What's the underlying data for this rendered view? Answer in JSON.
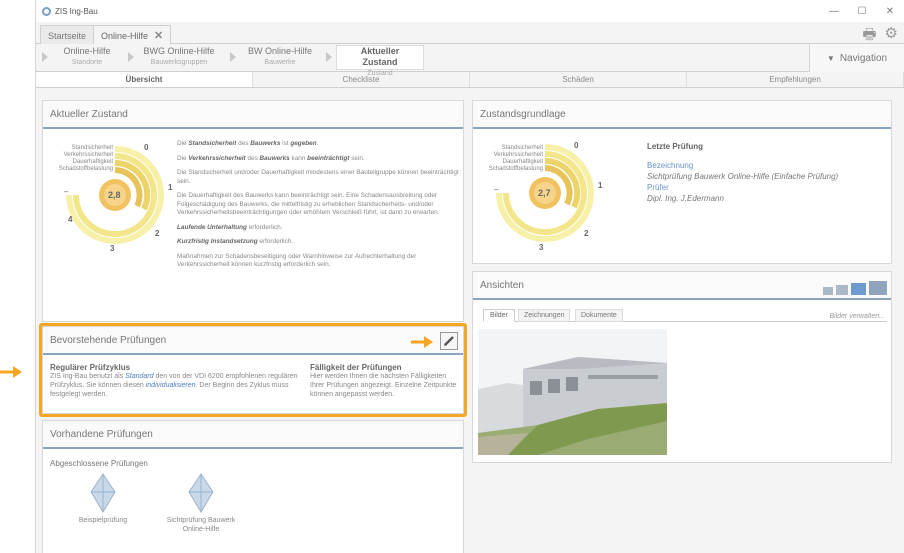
{
  "window": {
    "title": "ZIS Ing-Bau"
  },
  "tabs": [
    {
      "label": "Startseite"
    },
    {
      "label": "Online-Hilfe"
    }
  ],
  "breadcrumbs": [
    {
      "title": "Online-Hilfe",
      "sub": "Standorte"
    },
    {
      "title": "BWG Online-Hilfe",
      "sub": "Bauwerksgruppen"
    },
    {
      "title": "BW Online-Hilfe",
      "sub": "Bauwerke"
    },
    {
      "title": "Aktueller Zustand",
      "sub": "Zustand"
    }
  ],
  "nav_label": "Navigation",
  "subtabs": [
    "Übersicht",
    "Checkliste",
    "Schäden",
    "Empfehlungen"
  ],
  "zustand": {
    "title": "Aktueller Zustand",
    "gauge_labels": [
      "Standsicherheit",
      "Verkehrssicherheit",
      "Dauerhaftigkeit",
      "Schadstoffbelastung"
    ],
    "gauge_value": "2,8",
    "scale": [
      "0",
      "1",
      "2",
      "3",
      "4",
      "–"
    ],
    "texts": {
      "p1": {
        "a": "Die ",
        "b": "Standsicherheit",
        "c": " des ",
        "d": "Bauwerks",
        "e": " ist ",
        "f": "gegeben",
        "g": "."
      },
      "p2": {
        "a": "Die ",
        "b": "Verkehrssicherheit",
        "c": " des ",
        "d": "Bauwerks",
        "e": " kann ",
        "f": "beeinträchtigt",
        "g": " sein."
      },
      "p3": "Die Standsicherheit und/oder Dauerhaftigkeit mindestens einer Bauteilgruppe können beeinträchtigt sein.",
      "p4": "Die Dauerhaftigkeit des Bauwerks kann beeinträchtigt sein. Eine Schadensausbreitung oder Folgeschädigung des Bauwerks, die mittelfristig zu erheblichen Standsicherheits- und/oder Verkehrssicherheitsbeeinträchtigungen oder erhöhtem Verschleiß führt, ist dann zu erwarten.",
      "p5": {
        "a": "Laufende Unterhaltung",
        "b": " erforderlich."
      },
      "p6": {
        "a": "Kurzfristig Instandsetzung",
        "b": " erforderlich."
      },
      "p7": "Maßnahmen zur Schadensbeseitigung oder Warnhinweise zur Aufrechterhaltung der Verkehrssicherheit können kurzfristig erforderlich sein."
    }
  },
  "pruefungen": {
    "title": "Bevorstehende Prüfungen",
    "left_title": "Regulärer Prüfzyklus",
    "left_text": {
      "a": "ZIS Ing-Bau benutzt als ",
      "link1": "Standard",
      "b": " den von der VDI 6200 empfohlenen regulären Prüfzyklus. Sie können diesen ",
      "link2": "individualisieren",
      "c": ". Der Beginn des Zyklus muss  festgelegt werden."
    },
    "right_title": "Fälligkeit der Prüfungen",
    "right_text": "Hier werden Ihnen die nächsten Fälligkeiten Ihrer Prüfungen angezeigt. Einzelne Zeitpunkte können angepasst werden."
  },
  "vorhandene": {
    "title": "Vorhandene Prüfungen",
    "subtitle": "Abgeschlossene Prüfungen",
    "items": [
      {
        "label": "Beispielprüfung"
      },
      {
        "label": "Sichtprüfung Bauwerk Online-Hilfe"
      }
    ]
  },
  "grundlage": {
    "title": "Zustandsgrundlage",
    "gauge_labels": [
      "Standsicherheit",
      "Verkehrssicherheit",
      "Dauerhaftigkeit",
      "Schadstoffbelastung"
    ],
    "gauge_value": "2,7",
    "scale": [
      "0",
      "1",
      "2",
      "3",
      "–"
    ],
    "letzte_title": "Letzte Prüfung",
    "bezeichnung_label": "Bezeichnung",
    "bezeichnung_value": "Sichtprüfung Bauwerk Online-Hilfe (Einfache Prüfung)",
    "pruefer_label": "Prüfer",
    "pruefer_value": "Dipl. Ing. J.Edermann"
  },
  "ansichten": {
    "title": "Ansichten",
    "tabs": [
      "Bilder",
      "Zeichnungen",
      "Dokumente"
    ],
    "manage_link": "Bilder verwalten..."
  },
  "colors": {
    "accent": "#f5a623",
    "header_line": "#8aa3bf",
    "gauge_fill": "#f0b84a"
  }
}
